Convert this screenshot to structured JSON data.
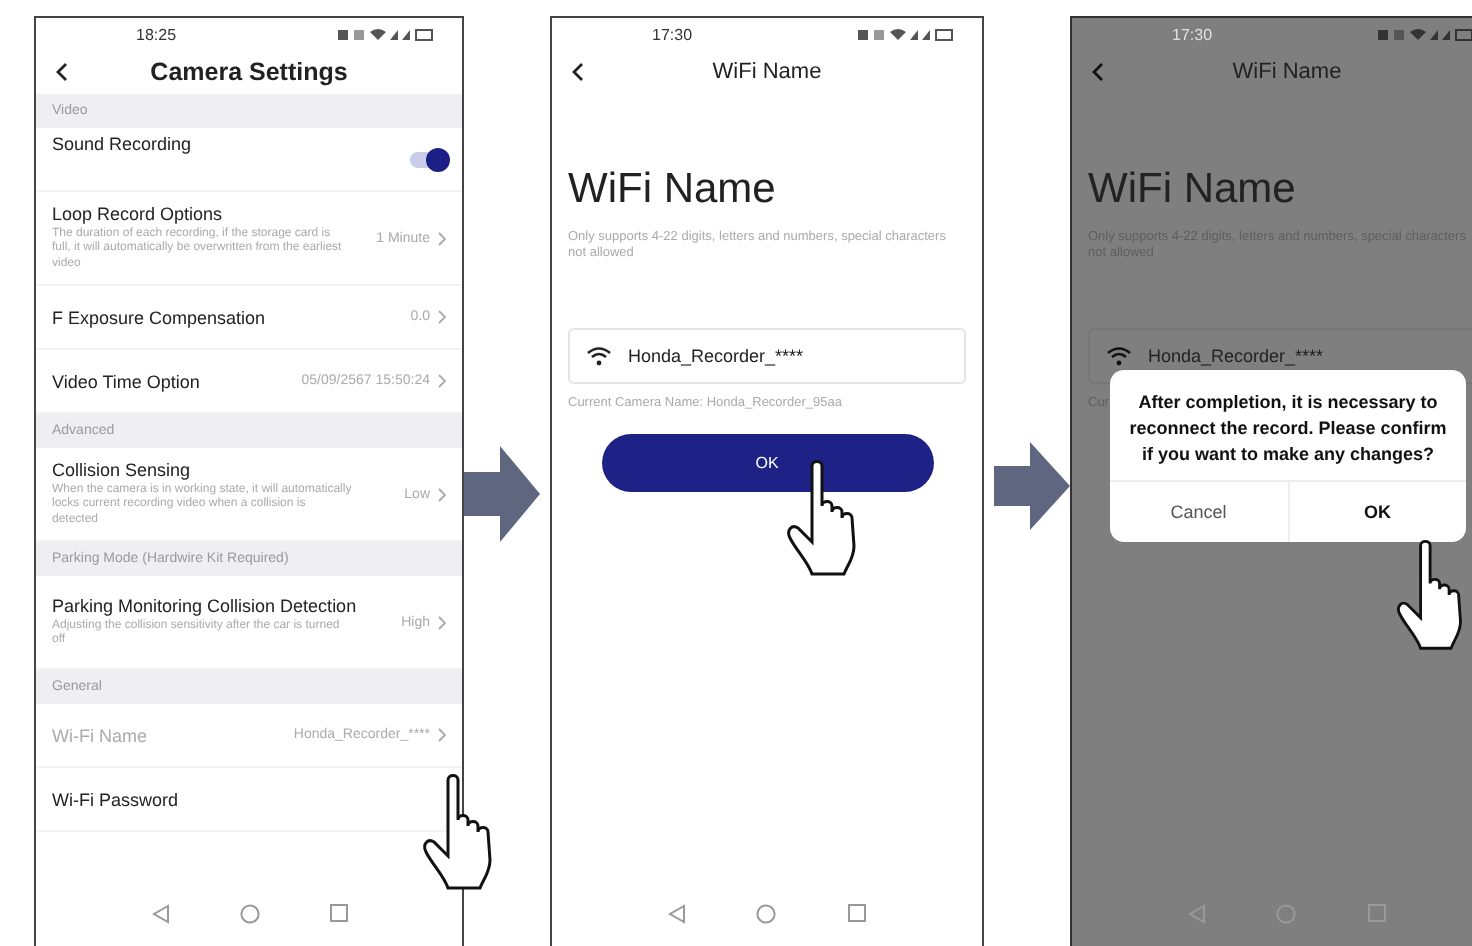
{
  "settings_screen": {
    "status_time": "18:25",
    "title": "Camera Settings",
    "items": [
      {
        "kind": "section",
        "label": "Video"
      },
      {
        "kind": "toggle",
        "label": "Sound Recording",
        "on": true
      },
      {
        "kind": "option",
        "label": "Loop Record Options",
        "description": "The duration of each recording, if the storage card is full, it will automatically be overwritten from the earliest video",
        "value": "1 Minute",
        "disabled": false
      },
      {
        "kind": "option",
        "label": "F Exposure Compensation",
        "value": "0.0",
        "disabled": false
      },
      {
        "kind": "option",
        "label": "Video Time Option",
        "value": "05/09/2567 15:50:24",
        "disabled": false
      },
      {
        "kind": "section",
        "label": "Advanced"
      },
      {
        "kind": "option",
        "label": "Collision Sensing",
        "description": "When the camera is in working state, it will automatically locks current recording video when a collision is detected",
        "value": "Low",
        "disabled": false
      },
      {
        "kind": "section",
        "label": "Parking Mode (Hardwire Kit Required)"
      },
      {
        "kind": "option",
        "label": "Parking Monitoring Collision Detection",
        "description": "Adjusting the collision sensitivity after the car is turned off",
        "value": "High",
        "disabled": false
      },
      {
        "kind": "section",
        "label": "General"
      },
      {
        "kind": "option",
        "label": "Wi-Fi Name",
        "value": "Honda_Recorder_****",
        "disabled": true
      },
      {
        "kind": "option",
        "label": "Wi-Fi Password",
        "disabled": false
      }
    ]
  },
  "wifi_name_screen": {
    "status_time": "17:30",
    "title": "WiFi Name",
    "heading": "WiFi Name",
    "hint": "Only supports 4-22 digits, letters and numbers, special characters not allowed",
    "field_value": "Honda_Recorder_****",
    "current_name": "Current Camera Name: Honda_Recorder_95aa",
    "button": "OK"
  },
  "confirm_screen": {
    "status_time": "17:30",
    "title": "WiFi Name",
    "heading": "WiFi Name",
    "hint": "Only supports 4-22 digits, letters and numbers, special characters not allowed",
    "field_value": "Honda_Recorder_****",
    "current_name": "Cur",
    "dialog": {
      "message": "After completion, it is necessary to reconnect the record. Please confirm if you want to make any changes?",
      "buttons": [
        "Cancel",
        "OK"
      ]
    }
  }
}
